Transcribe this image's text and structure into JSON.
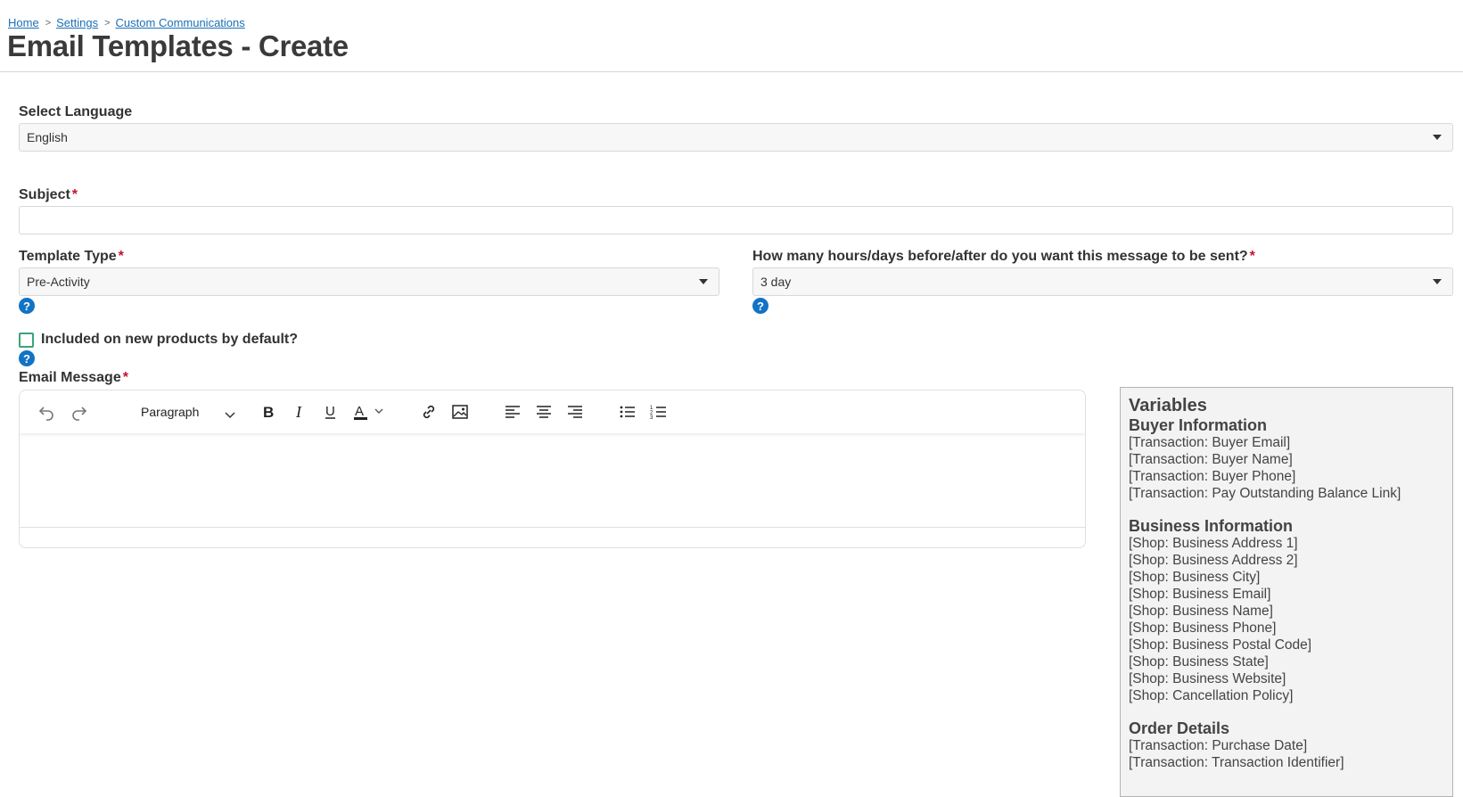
{
  "breadcrumb": [
    "Home",
    "Settings",
    "Custom Communications"
  ],
  "page_title": "Email Templates - Create",
  "language": {
    "label": "Select Language",
    "value": "English"
  },
  "subject": {
    "label": "Subject",
    "value": "",
    "placeholder": ""
  },
  "template_type": {
    "label": "Template Type",
    "value": "Pre-Activity"
  },
  "timing": {
    "label": "How many hours/days before/after do you want this message to be sent?",
    "value": "3 day"
  },
  "required_mark": "*",
  "help_glyph": "?",
  "default_checkbox": {
    "label": "Included on new products by default?",
    "checked": false
  },
  "email_message": {
    "label": "Email Message"
  },
  "toolbar": {
    "paragraph_label": "Paragraph"
  },
  "variables": {
    "title": "Variables",
    "groups": [
      {
        "title": "Buyer Information",
        "items": [
          "[Transaction: Buyer Email]",
          "[Transaction: Buyer Name]",
          "[Transaction: Buyer Phone]",
          "[Transaction: Pay Outstanding Balance Link]"
        ]
      },
      {
        "title": "Business Information",
        "items": [
          "[Shop: Business Address 1]",
          "[Shop: Business Address 2]",
          "[Shop: Business City]",
          "[Shop: Business Email]",
          "[Shop: Business Name]",
          "[Shop: Business Phone]",
          "[Shop: Business Postal Code]",
          "[Shop: Business State]",
          "[Shop: Business Website]",
          "[Shop: Cancellation Policy]"
        ]
      },
      {
        "title": "Order Details",
        "items": [
          "[Transaction: Purchase Date]",
          "[Transaction: Transaction Identifier]"
        ]
      }
    ]
  }
}
